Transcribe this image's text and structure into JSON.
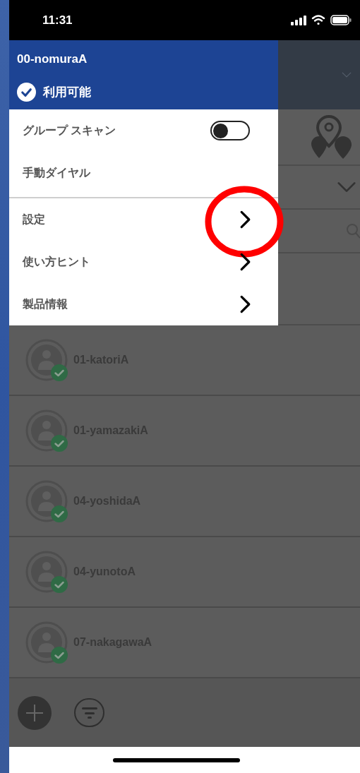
{
  "status_bar": {
    "time": "11:31"
  },
  "drawer": {
    "user": "00-nomuraA",
    "status": "利用可能",
    "sections": [
      [
        {
          "kind": "toggle",
          "label": "グループ スキャン",
          "on": false,
          "circled": false
        },
        {
          "kind": "plain",
          "label": "手動ダイヤル",
          "circled": false
        }
      ],
      [
        {
          "kind": "link",
          "label": "設定",
          "circled": true
        },
        {
          "kind": "link",
          "label": "使い方ヒント",
          "circled": false
        },
        {
          "kind": "link",
          "label": "製品情報",
          "circled": false
        }
      ]
    ]
  },
  "contacts": [
    {
      "name": "01-katoriA",
      "available": true
    },
    {
      "name": "01-yamazakiA",
      "available": true
    },
    {
      "name": "04-yoshidaA",
      "available": true
    },
    {
      "name": "04-yunotoA",
      "available": true
    },
    {
      "name": "07-nakagawaA",
      "available": true
    }
  ]
}
